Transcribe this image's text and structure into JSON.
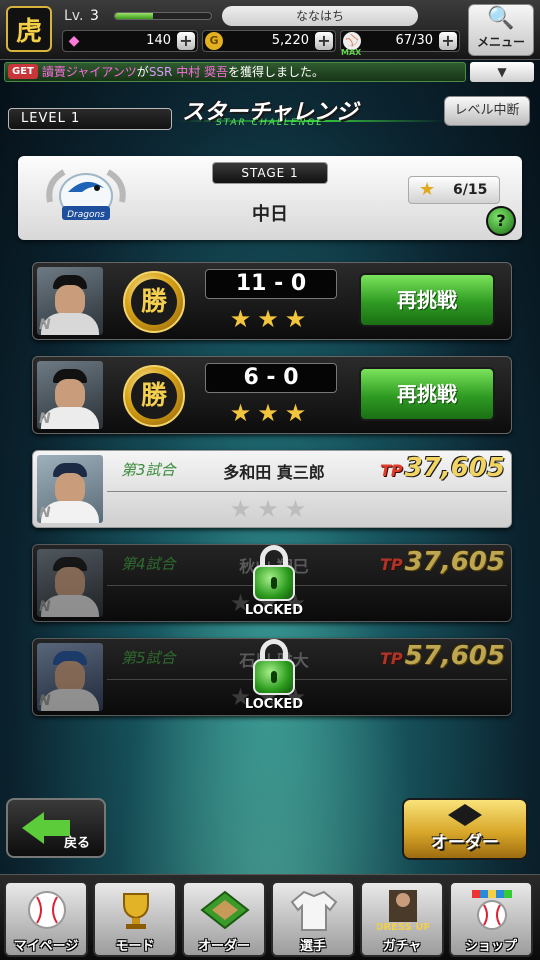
{
  "topbar": {
    "level_label": "Lv.",
    "level_value": "3",
    "exp_fraction": 0.4,
    "player_name": "ななはち",
    "gems": "140",
    "coins": "5,220",
    "stamina": "67/30",
    "stamina_tag": "MAX",
    "menu_label": "メニュー"
  },
  "ticker": {
    "badge": "GET",
    "team": "讀賣ジャイアンツ",
    "particle": "が",
    "rank": "SSR",
    "player": "中村 奨吾",
    "suffix": "を獲得しました。"
  },
  "header": {
    "level_tag": "LEVEL 1",
    "title": "スターチャレンジ",
    "subtitle": "STAR CHALLENGE",
    "quit_button": "レベル中断"
  },
  "stage": {
    "label": "STAGE 1",
    "opponent": "中日",
    "stars": "6/15",
    "logo_text": "Dragons",
    "help": "?"
  },
  "matches": [
    {
      "result": "勝",
      "score": "11 - 0",
      "stars": "★★★",
      "button": "再挑戦"
    },
    {
      "result": "勝",
      "score": "6 - 0",
      "stars": "★★★",
      "button": "再挑戦"
    },
    {
      "game": "第3試合",
      "opponent": "多和田 真三郎",
      "tp_label": "TP",
      "tp": "37,605",
      "stars": "★★★"
    },
    {
      "game": "第4試合",
      "opponent": "秋山 翔巳",
      "tp_label": "TP",
      "tp": "37,605",
      "stars": "★★★",
      "locked": "LOCKED"
    },
    {
      "game": "第5試合",
      "opponent": "石川 雅大",
      "tp_label": "TP",
      "tp": "57,605",
      "stars": "★★★",
      "locked": "LOCKED"
    }
  ],
  "buttons": {
    "back": "戻る",
    "order": "オーダー"
  },
  "nav": [
    {
      "label": "マイページ",
      "icon": "baseball-icon"
    },
    {
      "label": "モード",
      "icon": "trophy-icon"
    },
    {
      "label": "オーダー",
      "icon": "field-icon"
    },
    {
      "label": "選手",
      "icon": "uniform-icon"
    },
    {
      "label": "ガチャ",
      "icon": "dress-up-icon",
      "badge": "DRESS UP"
    },
    {
      "label": "ショップ",
      "icon": "shop-icon"
    }
  ],
  "colors": {
    "accent_green": "#2e9b22",
    "gold": "#d9a419",
    "tp_gold": "#f2d463",
    "get_red": "#c9363a"
  }
}
